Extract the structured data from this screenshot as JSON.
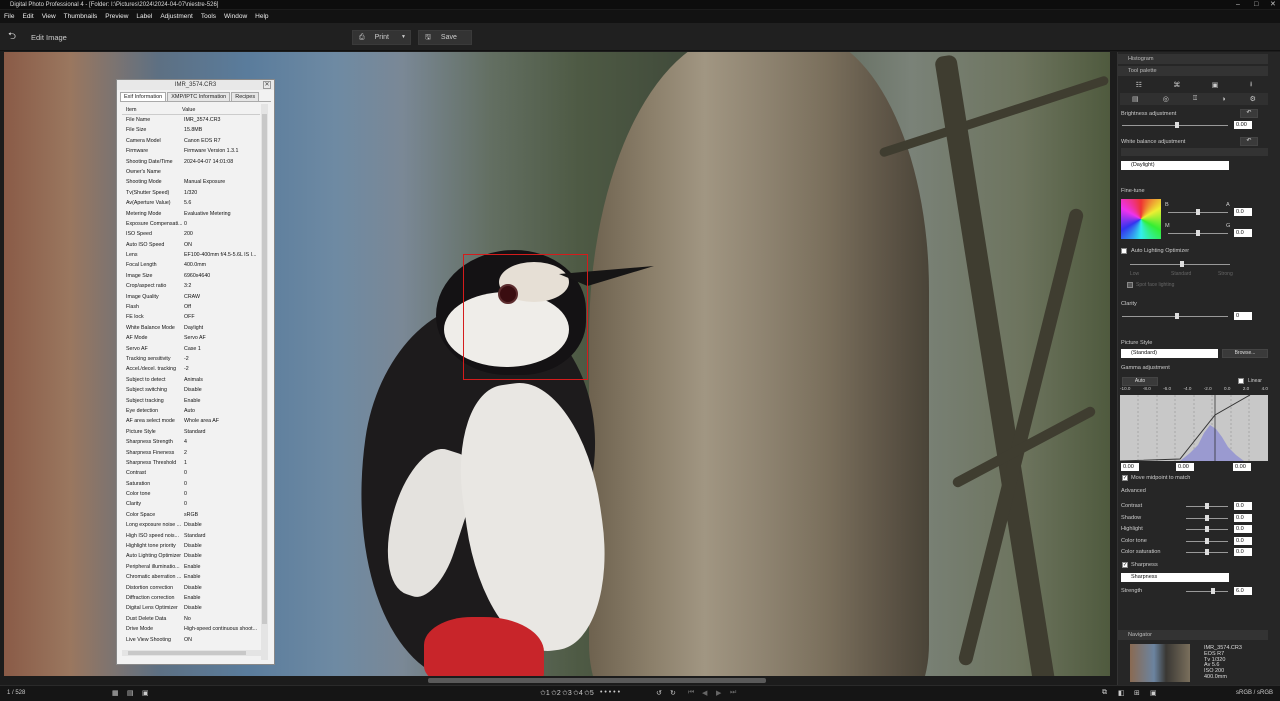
{
  "window": {
    "title": "Digital Photo Professional 4 - [Folder: I:\\Pictures\\2024\\2024-04-07\\niestre-526]",
    "min": "–",
    "max": "□",
    "close": "✕"
  },
  "menu": [
    "File",
    "Edit",
    "View",
    "Thumbnails",
    "Preview",
    "Label",
    "Adjustment",
    "Tools",
    "Window",
    "Help"
  ],
  "toolbar": {
    "edit_label": "Edit Image",
    "print_label": "Print",
    "save_label": "Save"
  },
  "exif": {
    "title": "IMR_3574.CR3",
    "tabs": [
      "Exif Information",
      "XMP/IPTC Information",
      "Recipes"
    ],
    "header": {
      "item": "Item",
      "value": "Value"
    },
    "rows": [
      [
        "File Name",
        "IMR_3574.CR3"
      ],
      [
        "File Size",
        "15.8MB"
      ],
      [
        "Camera Model",
        "Canon EOS R7"
      ],
      [
        "Firmware",
        "Firmware Version 1.3.1"
      ],
      [
        "Shooting Date/Time",
        "2024-04-07 14:01:08"
      ],
      [
        "Owner's Name",
        ""
      ],
      [
        "Shooting Mode",
        "Manual Exposure"
      ],
      [
        "Tv(Shutter Speed)",
        "1/320"
      ],
      [
        "Av(Aperture Value)",
        "5.6"
      ],
      [
        "Metering Mode",
        "Evaluative Metering"
      ],
      [
        "Exposure Compensati...",
        "0"
      ],
      [
        "ISO Speed",
        "200"
      ],
      [
        "Auto ISO Speed",
        "ON"
      ],
      [
        "Lens",
        "EF100-400mm f/4.5-5.6L IS I..."
      ],
      [
        "Focal Length",
        "400.0mm"
      ],
      [
        "Image Size",
        "6960x4640"
      ],
      [
        "Crop/aspect ratio",
        "3:2"
      ],
      [
        "Image Quality",
        "CRAW"
      ],
      [
        "Flash",
        "Off"
      ],
      [
        "FE lock",
        "OFF"
      ],
      [
        "White Balance Mode",
        "Daylight"
      ],
      [
        "AF Mode",
        "Servo AF"
      ],
      [
        "Servo AF",
        "Case 1"
      ],
      [
        "Tracking sensitivity",
        "-2"
      ],
      [
        "Accel./decel. tracking",
        "-2"
      ],
      [
        "Subject to detect",
        "Animals"
      ],
      [
        "Subject switching",
        "Disable"
      ],
      [
        "Subject tracking",
        "Enable"
      ],
      [
        "Eye detection",
        "Auto"
      ],
      [
        "AF area select mode",
        "Whole area AF"
      ],
      [
        "Picture Style",
        "Standard"
      ],
      [
        "Sharpness Strength",
        "4"
      ],
      [
        "Sharpness Fineness",
        "2"
      ],
      [
        "Sharpness Threshold",
        "1"
      ],
      [
        "Contrast",
        "0"
      ],
      [
        "Saturation",
        "0"
      ],
      [
        "Color tone",
        "0"
      ],
      [
        "Clarity",
        "0"
      ],
      [
        "Color Space",
        "sRGB"
      ],
      [
        "Long exposure noise ...",
        "Disable"
      ],
      [
        "High ISO speed nois...",
        "Standard"
      ],
      [
        "Highlight tone priority",
        "Disable"
      ],
      [
        "Auto Lighting Optimizer",
        "Disable"
      ],
      [
        "Peripheral illuminatio...",
        "Enable"
      ],
      [
        "Chromatic aberration ...",
        "Enable"
      ],
      [
        "Distortion correction",
        "Disable"
      ],
      [
        "Diffraction correction",
        "Enable"
      ],
      [
        "Digital Lens Optimizer",
        "Disable"
      ],
      [
        "Dust Delete Data",
        "No"
      ],
      [
        "Drive Mode",
        "High-speed continuous shoot..."
      ],
      [
        "Live View Shooting",
        "ON"
      ]
    ]
  },
  "panel": {
    "histogram": "Histogram",
    "tool_palette": "Tool palette",
    "brightness": {
      "label": "Brightness adjustment",
      "value": "0.00"
    },
    "wb": {
      "label": "White balance adjustment",
      "preset": "(Daylight)"
    },
    "finetune": {
      "label": "Fine-tune",
      "b": "B",
      "a": "A",
      "m": "M",
      "g": "G",
      "ba_value": "0.0",
      "mg_value": "0.0"
    },
    "alo": {
      "label": "Auto Lighting Optimizer",
      "low": "Low",
      "standard": "Standard",
      "strong": "Strong",
      "spot": "Spot face lighting"
    },
    "clarity": {
      "label": "Clarity",
      "value": "0"
    },
    "picture_style": {
      "label": "Picture Style",
      "value": "(Standard)",
      "browse": "Browse..."
    },
    "gamma": {
      "label": "Gamma adjustment",
      "auto": "Auto",
      "linear": "Linear",
      "ticks": [
        "-10.0",
        "-8.0",
        "-6.0",
        "-4.0",
        "-2.0",
        "0.0",
        "2.0",
        "4.0"
      ],
      "v1": "0.00",
      "v2": "0.00",
      "v3": "0.00",
      "move_midpoint": "Move midpoint to match"
    },
    "advanced": {
      "label": "Advanced",
      "items": [
        [
          "Contrast",
          "0.0"
        ],
        [
          "Shadow",
          "0.0"
        ],
        [
          "Highlight",
          "0.0"
        ],
        [
          "Color tone",
          "0.0"
        ],
        [
          "Color saturation",
          "0.0"
        ]
      ]
    },
    "sharpness": {
      "label": "Sharpness",
      "mode": "Sharpness",
      "strength_label": "Strength",
      "strength": "6.0"
    },
    "navigator": {
      "label": "Navigator",
      "info": [
        "IMR_3574.CR3",
        "EOS R7",
        "Tv 1/320",
        "Av 5.6",
        "ISO 200",
        "400.0mm"
      ]
    }
  },
  "status": {
    "count": "1 / 528",
    "colorspace": "sRGB / sRGB"
  }
}
